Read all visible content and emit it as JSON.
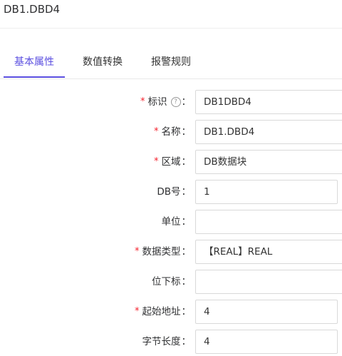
{
  "header": {
    "title": "DB1.DBD4"
  },
  "tabs": [
    {
      "label": "基本属性"
    },
    {
      "label": "数值转换"
    },
    {
      "label": "报警规则"
    }
  ],
  "colors": {
    "accent": "#5b4fe0",
    "required": "#f5222d"
  },
  "form": {
    "fields": [
      {
        "label": "标识",
        "required": true,
        "help": true,
        "value": "DB1DBD4"
      },
      {
        "label": "名称",
        "required": true,
        "value": "DB1.DBD4"
      },
      {
        "label": "区域",
        "required": true,
        "value": "DB数据块"
      },
      {
        "label": "DB号",
        "required": false,
        "value": "1"
      },
      {
        "label": "单位",
        "required": false,
        "value": ""
      },
      {
        "label": "数据类型",
        "required": true,
        "value": "【REAL】REAL"
      },
      {
        "label": "位下标",
        "required": false,
        "value": ""
      },
      {
        "label": "起始地址",
        "required": true,
        "value": "4"
      },
      {
        "label": "字节长度",
        "required": false,
        "value": "4"
      }
    ],
    "colon": "：",
    "required_mark": "*",
    "help_glyph": "?"
  }
}
